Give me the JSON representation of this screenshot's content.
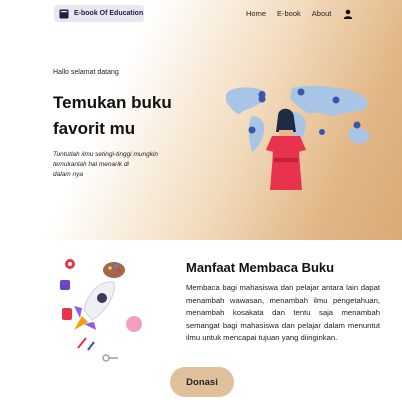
{
  "navbar": {
    "brand": "E-book Of Education",
    "links": [
      "Home",
      "E-book",
      "About"
    ],
    "user_icon": "user-icon"
  },
  "hero": {
    "greeting": "Hallo selamat datang",
    "headline_line1": "Temukan buku",
    "headline_line2": "favorit mu",
    "subtext_line1": "Tuntutlah ilmu setingi-tinggi mungkin",
    "subtext_line2": "temukanlah hal menarik di",
    "subtext_line3": "dalam nya",
    "illustration": "woman-world-map-illustration"
  },
  "benefit": {
    "title": "Manfaat Membaca Buku",
    "body": "Membaca bagi mahasiswa dan pelajar antara lain dapat menambah wawasan, menambah ilmu pengetahuan, menambah kosakata dan tentu saja menambah semangat bagi mahasiswa dan pelajar dalam menuntut ilmu untuk mencapai tujuan yang diinginkan.",
    "illustration": "rocket-illustration"
  },
  "donate": {
    "label": "Donasi"
  },
  "colors": {
    "hero_gradient_end": "#d8aa76",
    "button_bg": "#dfc09a",
    "map": "#a8c5e6",
    "figure_top": "#e8334d"
  }
}
